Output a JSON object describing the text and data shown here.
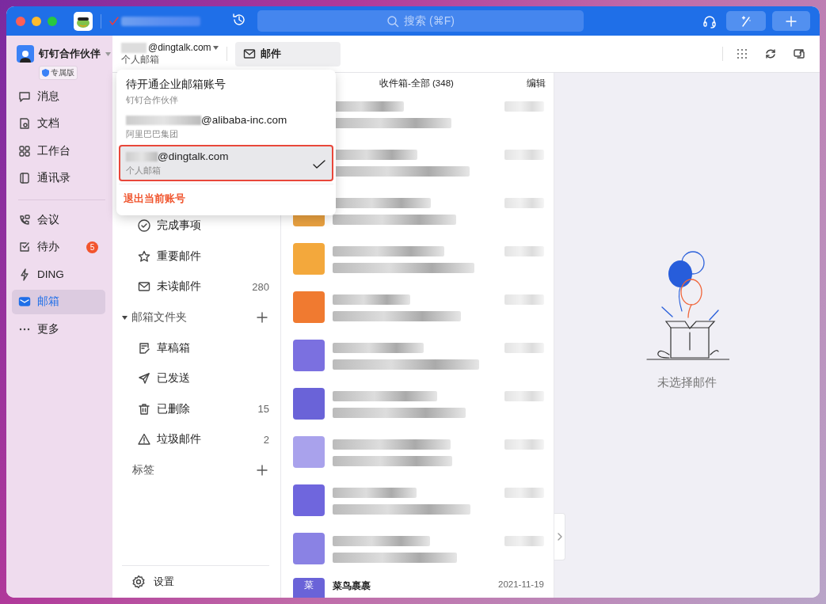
{
  "titlebar": {
    "search_placeholder": "搜索 (⌘F)"
  },
  "sidebar": {
    "user": "钉钉合作伙伴",
    "edition": "专属版",
    "groups": [
      [
        {
          "label": "消息",
          "kind": "chat",
          "selected": false
        },
        {
          "label": "文档",
          "kind": "doc",
          "selected": false
        },
        {
          "label": "工作台",
          "kind": "apps",
          "selected": false
        },
        {
          "label": "通讯录",
          "kind": "contacts",
          "selected": false
        }
      ],
      [
        {
          "label": "会议",
          "kind": "meeting",
          "selected": false
        },
        {
          "label": "待办",
          "kind": "todo",
          "badge": "5",
          "selected": false
        },
        {
          "label": "DING",
          "kind": "ding",
          "selected": false
        },
        {
          "label": "邮箱",
          "kind": "mail",
          "selected": true
        },
        {
          "label": "更多",
          "kind": "more",
          "selected": false
        }
      ]
    ]
  },
  "toolbar": {
    "account": {
      "address": "@dingtalk.com",
      "type": "个人邮箱"
    },
    "tabs": [
      {
        "label": "邮件",
        "selected": true
      }
    ]
  },
  "account_menu": {
    "accounts": [
      {
        "address": "待开通企业邮箱账号",
        "org": "钉钉合作伙伴",
        "redacted": false,
        "selected": false
      },
      {
        "address": "@alibaba-inc.com",
        "org": "阿里巴巴集团",
        "redacted": true,
        "selected": false
      },
      {
        "address": "@dingtalk.com",
        "org": "个人邮箱",
        "redacted": true,
        "selected": true
      }
    ],
    "logout": "退出当前账号"
  },
  "folders": {
    "items": [
      {
        "label": "完成事项",
        "kind": "done"
      },
      {
        "label": "重要邮件",
        "kind": "star"
      },
      {
        "label": "未读邮件",
        "kind": "mail",
        "count": "280"
      }
    ],
    "section": {
      "label": "邮箱文件夹",
      "expanded": true,
      "items": [
        {
          "label": "草稿箱",
          "kind": "draft"
        },
        {
          "label": "已发送",
          "kind": "sent"
        },
        {
          "label": "已删除",
          "kind": "trash",
          "count": "15"
        },
        {
          "label": "垃圾邮件",
          "kind": "spam",
          "count": "2"
        }
      ]
    },
    "tags": "标签",
    "settings": "设置"
  },
  "mail_list": {
    "title": "收件箱-全部 (348)",
    "edit": "编辑",
    "rows": [
      {},
      {},
      {
        "color": "#e8a040"
      },
      {
        "color": "#f3a83c"
      },
      {
        "color": "#f07a30"
      },
      {
        "color": "#7b70e0"
      },
      {
        "color": "#6a63d8"
      },
      {
        "color": "#a9a2ec"
      },
      {
        "color": "#6f66dd"
      },
      {
        "color": "#8a82e4"
      },
      {
        "color": "#6a63d8",
        "sender": "菜鸟裹裹",
        "avatar": "菜",
        "date": "2021-11-19"
      }
    ]
  },
  "preview": {
    "empty_text": "未选择邮件"
  }
}
